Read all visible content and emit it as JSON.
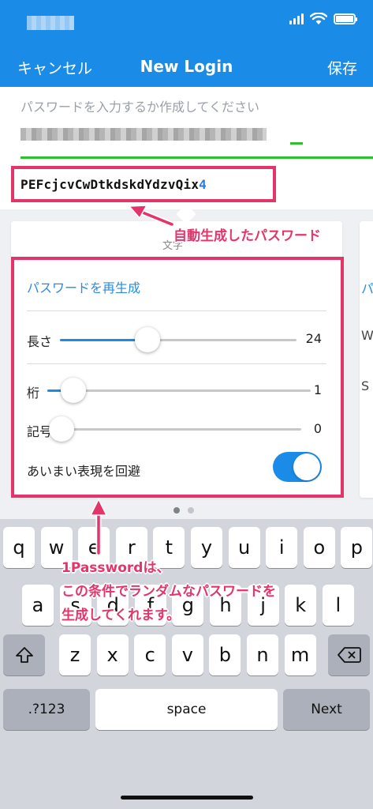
{
  "nav": {
    "cancel": "キャンセル",
    "title": "New Login",
    "save": "保存"
  },
  "password_field": {
    "placeholder": "パスワードを入力するか作成してください"
  },
  "generated_password": {
    "main": "PEFcjcvCwDtkdskdYdzvQix",
    "last_digit": "4"
  },
  "generator": {
    "tab_label": "文字",
    "regenerate": "パスワードを再生成",
    "length": {
      "label": "長さ",
      "value": "24",
      "fraction": 0.37
    },
    "digits": {
      "label": "桁",
      "value": "1",
      "fraction": 0.1
    },
    "symbols": {
      "label": "記号",
      "value": "0",
      "fraction": 0.0
    },
    "avoid_ambiguous": {
      "label": "あいまい表現を回避",
      "on": true
    },
    "right_peek": {
      "heading": "パ",
      "row1": "W",
      "row2": "S"
    },
    "pages": {
      "count": 2,
      "active": 0
    }
  },
  "annotations": {
    "generated": "自動生成したパスワード",
    "explain_line1": "1Passwordは、",
    "explain_line2": "この条件でランダムなパスワードを",
    "explain_line3": "生成してくれます。"
  },
  "keyboard": {
    "row1": [
      "q",
      "w",
      "e",
      "r",
      "t",
      "y",
      "u",
      "i",
      "o",
      "p"
    ],
    "row2": [
      "a",
      "s",
      "d",
      "f",
      "g",
      "h",
      "j",
      "k",
      "l"
    ],
    "row3": [
      "z",
      "x",
      "c",
      "v",
      "b",
      "n",
      "m"
    ],
    "numbers": ".?123",
    "space": "space",
    "next": "Next",
    "icons": {
      "shift": "shift-icon",
      "delete": "delete-icon"
    }
  },
  "colors": {
    "brand_blue": "#1a8ce8",
    "annotation_pink": "#e4356b",
    "strength_green": "#2ec02e"
  }
}
